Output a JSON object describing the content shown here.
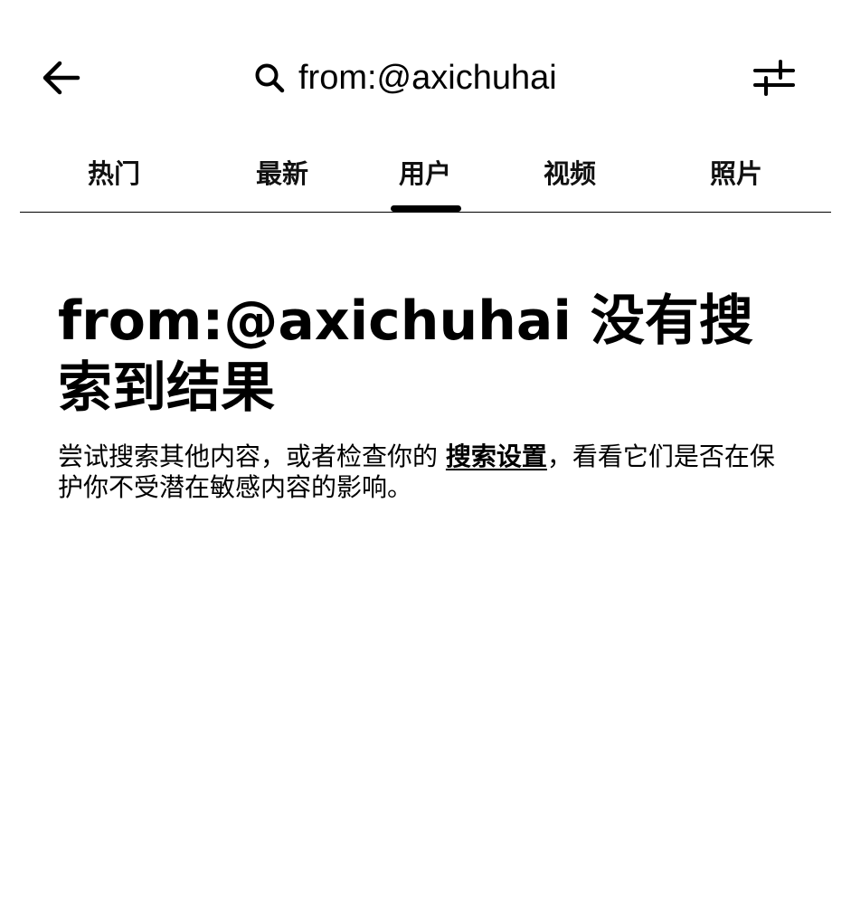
{
  "header": {
    "back_icon": "arrow-left-icon",
    "search_icon": "search-icon",
    "search_query": "from:@axichuhai",
    "filter_icon": "sliders-icon"
  },
  "tabs": [
    {
      "label": "热门",
      "active": false
    },
    {
      "label": "最新",
      "active": false
    },
    {
      "label": "用户",
      "active": true
    },
    {
      "label": "视频",
      "active": false
    },
    {
      "label": "照片",
      "active": false
    }
  ],
  "empty_state": {
    "title": "from:@axichuhai 没有搜索到结果",
    "description_before": "尝试搜索其他内容，或者检查你的 ",
    "settings_link": "搜索设置",
    "description_after": "，看看它们是否在保护你不受潜在敏感内容的影响。"
  },
  "colors": {
    "text": "#000000",
    "background": "#ffffff",
    "tab_indicator": "#000000"
  }
}
